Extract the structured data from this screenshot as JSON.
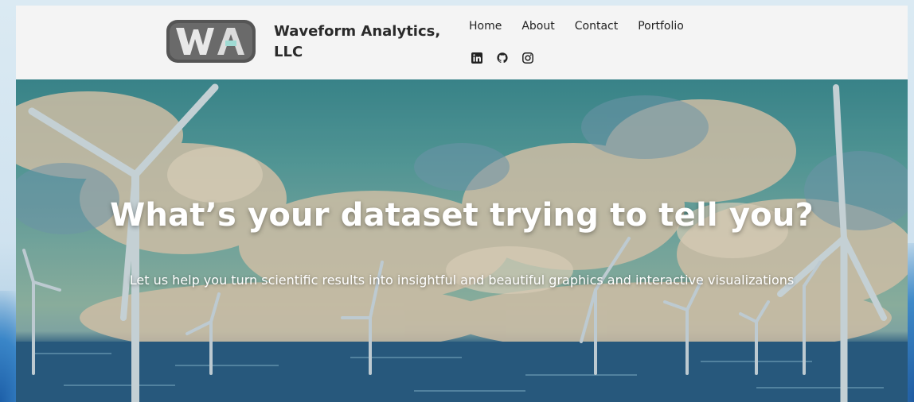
{
  "brand": {
    "name": "Waveform Analytics, LLC",
    "logo_icon": "wa-logo-icon"
  },
  "nav": {
    "items": [
      {
        "label": "Home"
      },
      {
        "label": "About"
      },
      {
        "label": "Contact"
      },
      {
        "label": "Portfolio"
      }
    ]
  },
  "social": {
    "icons": [
      "linkedin-icon",
      "github-icon",
      "instagram-icon"
    ]
  },
  "hero": {
    "title": "What’s your dataset trying to tell you?",
    "subtitle": "Let us help you turn scientific results into insightful and beautiful graphics and interactive visualizations"
  },
  "colors": {
    "header_bg": "#f4f4f4",
    "text_dark": "#222222",
    "hero_text": "#ffffff"
  }
}
